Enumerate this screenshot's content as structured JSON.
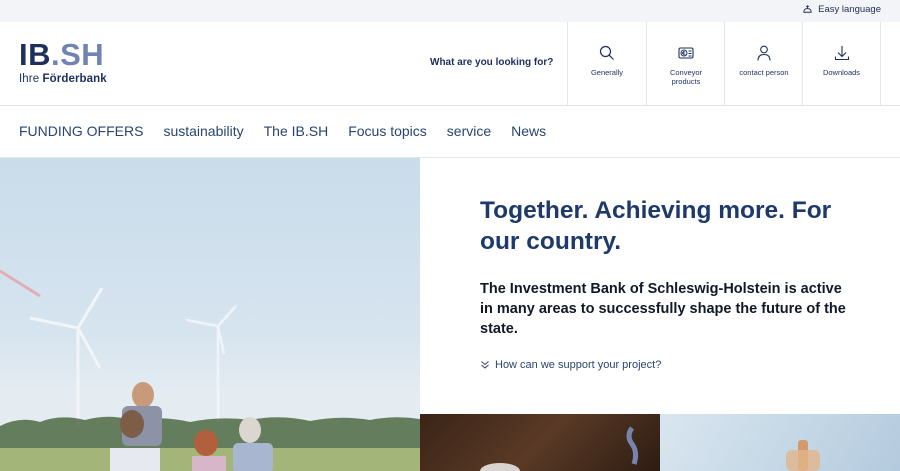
{
  "topbar": {
    "easy_language": "Easy language"
  },
  "logo": {
    "main_a": "IB",
    "main_b": ".SH",
    "sub_a": "Ihre ",
    "sub_b": "Förderbank"
  },
  "header": {
    "search_label": "What are you looking for?",
    "tools": [
      {
        "label": "Generally",
        "icon": "search-icon"
      },
      {
        "label": "Conveyor products",
        "icon": "euro-coins-icon"
      },
      {
        "label": "contact person",
        "icon": "person-icon"
      },
      {
        "label": "Downloads",
        "icon": "download-icon"
      }
    ]
  },
  "nav": {
    "items": [
      "FUNDING OFFERS",
      "sustainability",
      "The IB.SH",
      "Focus topics",
      "service",
      "News"
    ]
  },
  "hero": {
    "title": "Together. Achieving more. For our country.",
    "lead": "The Investment Bank of Schleswig-Holstein is active in many areas to successfully shape the future of the state.",
    "cta": "How can we support your project?"
  },
  "colors": {
    "brand_dark": "#1e2f5d",
    "brand_light": "#7183b2",
    "hero_title": "#1e3a6a"
  }
}
